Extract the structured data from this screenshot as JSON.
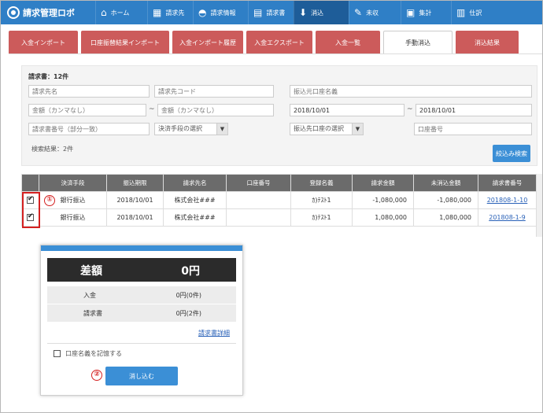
{
  "app": {
    "title": "請求管理ロボ"
  },
  "nav": [
    {
      "icon": "home-icon",
      "glyph": "⌂",
      "label": "ホーム",
      "active": false
    },
    {
      "icon": "building-icon",
      "glyph": "▦",
      "label": "請求先",
      "active": false
    },
    {
      "icon": "info-icon",
      "glyph": "◓",
      "label": "請求情報",
      "active": false
    },
    {
      "icon": "document-icon",
      "glyph": "▤",
      "label": "請求書",
      "active": false
    },
    {
      "icon": "download-icon",
      "glyph": "⬇",
      "label": "消込",
      "active": true
    },
    {
      "icon": "edit-icon",
      "glyph": "✎",
      "label": "未収",
      "active": false
    },
    {
      "icon": "calculator-icon",
      "glyph": "▣",
      "label": "集計",
      "active": false
    },
    {
      "icon": "journal-icon",
      "glyph": "▥",
      "label": "仕訳",
      "active": false
    }
  ],
  "tabs": [
    {
      "label": "入金インポート",
      "active": false
    },
    {
      "label": "口座振替結果インポート",
      "active": false
    },
    {
      "label": "入金インポート履歴",
      "active": false
    },
    {
      "label": "入金エクスポート",
      "active": false
    },
    {
      "label": "入金一覧",
      "active": false
    },
    {
      "label": "手動消込",
      "active": true
    },
    {
      "label": "消込結果",
      "active": false
    }
  ],
  "search": {
    "count_label": "請求書：12件",
    "billing_name_ph": "請求先名",
    "billing_code_ph": "請求先コード",
    "transfer_name_ph": "振込元口座名義",
    "amount_from_ph": "金額（カンマなし）",
    "amount_to_ph": "金額（カンマなし）",
    "date_from": "2018/10/01",
    "date_to": "2018/10/01",
    "invoice_no_ph": "請求書番号（部分一致）",
    "method_select": "決済手段の選択",
    "account_select": "振込先口座の選択",
    "account_no_ph": "口座番号",
    "result_label": "検索結果：2件",
    "filter_button": "絞込み検索"
  },
  "table": {
    "headers": [
      "決済手段",
      "振込期限",
      "請求先名",
      "口座番号",
      "登録名義",
      "請求金額",
      "未消込金額",
      "請求書番号"
    ],
    "rows": [
      {
        "checked": true,
        "method": "銀行振込",
        "due": "2018/10/01",
        "client": "株式会社###",
        "account": "",
        "holder": "ｶ)ﾃｽﾄ1",
        "amount": "-1,080,000",
        "unapplied": "-1,080,000",
        "invoice": "201808-1-10"
      },
      {
        "checked": true,
        "method": "銀行振込",
        "due": "2018/10/01",
        "client": "株式会社###",
        "account": "",
        "holder": "ｶ)ﾃｽﾄ1",
        "amount": "1,080,000",
        "unapplied": "1,080,000",
        "invoice": "201808-1-9"
      }
    ]
  },
  "markers": {
    "one": "①",
    "two": "②"
  },
  "popup": {
    "diff_label": "差額",
    "diff_value": "0円",
    "deposit_label": "入金",
    "deposit_value": "0円(0件)",
    "invoice_label": "請求書",
    "invoice_value": "0円(2件)",
    "detail_link": "請求書詳細",
    "remember_label": "口座名義を記憶する",
    "apply_button": "消し込む"
  },
  "colors": {
    "nav": "#2f7fc6",
    "tab": "#cc5b5b",
    "button": "#3b8fd6",
    "marker": "#d42020"
  }
}
